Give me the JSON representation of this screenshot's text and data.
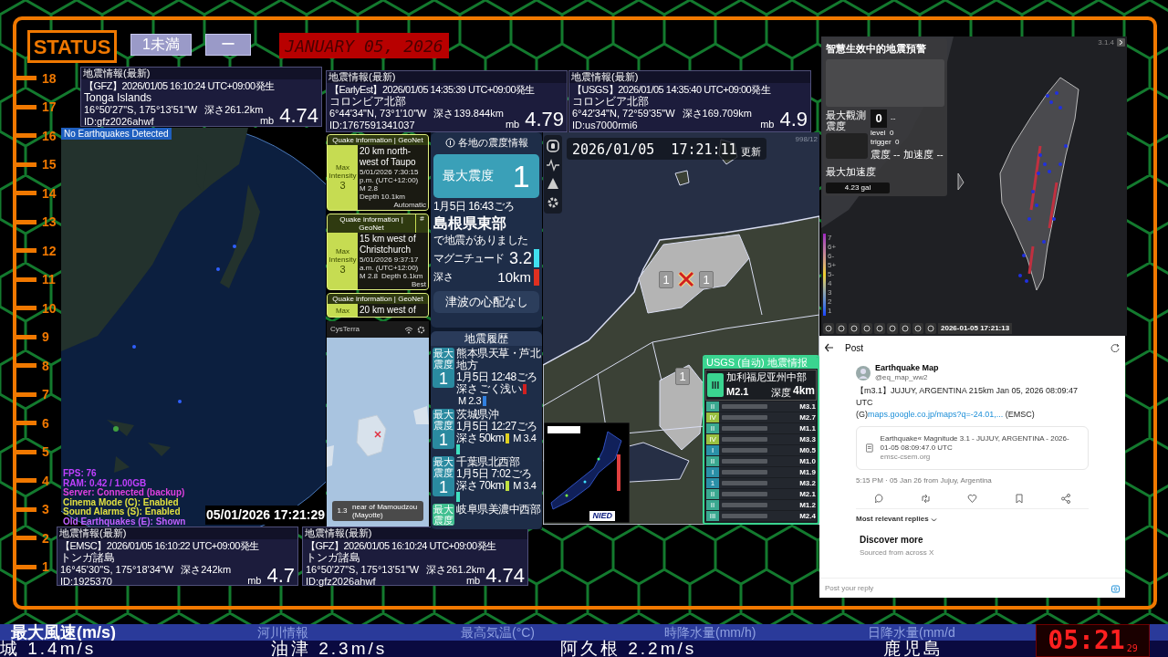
{
  "status": {
    "label": "STATUS",
    "badges": [
      "1未満",
      "ー"
    ],
    "date": "JANUARY 05, 2026"
  },
  "ruler": [
    "18",
    "17",
    "16",
    "15",
    "14",
    "13",
    "12",
    "11",
    "10",
    "9",
    "8",
    "7",
    "6",
    "5",
    "4",
    "3",
    "2",
    "1"
  ],
  "quake_cards": [
    {
      "header": "地震情報(最新)",
      "source": "【GFZ】2026/01/05  16:10:24  UTC+09:00発生",
      "region": "Tonga Islands",
      "coords": "16°50'27\"S, 175°13'51\"W",
      "depth": "深さ261.2km",
      "id": "ID:gfz2026ahwf",
      "mag_type": "mb",
      "magnitude": "4.74"
    },
    {
      "header": "地震情報(最新)",
      "source": "【EarlyEst】2026/01/05  14:35:39  UTC+09:00発生",
      "region": "コロンビア北部",
      "coords": "6°44'34\"N, 73°1'10\"W",
      "depth": "深さ139.844km",
      "id": "ID:1767591341037",
      "mag_type": "mb",
      "magnitude": "4.79"
    },
    {
      "header": "地震情報(最新)",
      "source": "【USGS】2026/01/05  14:35:40  UTC+09:00発生",
      "region": "コロンビア北部",
      "coords": "6°42'34\"N, 72°59'35\"W",
      "depth": "深さ169.709km",
      "id": "ID:us7000rmi6",
      "mag_type": "mb",
      "magnitude": "4.9"
    },
    {
      "header": "地震情報(最新)",
      "source": "【EMSC】2026/01/05  16:10:22  UTC+09:00発生",
      "region": "トンガ諸島",
      "coords": "16°45'30\"S, 175°18'34\"W",
      "depth": "深さ242km",
      "id": "ID:1925370",
      "mag_type": "mb",
      "magnitude": "4.7"
    },
    {
      "header": "地震情報(最新)",
      "source": "【GFZ】2026/01/05  16:10:24  UTC+09:00発生",
      "region": "トンガ諸島",
      "coords": "16°50'27\"S, 175°13'51\"W",
      "depth": "深さ261.2km",
      "id": "ID:gfz2026ahwf",
      "mag_type": "mb",
      "magnitude": "4.74"
    }
  ],
  "globe": {
    "badge": "No Earthquakes Detected",
    "stats": [
      {
        "text": "FPS: 76",
        "color": "#c040ff"
      },
      {
        "text": "RAM: 0.42 / 1.00GB",
        "color": "#c040ff"
      },
      {
        "text": "Server: Connected (backup)",
        "color": "#e040e0"
      },
      {
        "text": "Cinema Mode (C): Enabled",
        "color": "#e0e040"
      },
      {
        "text": "Sound Alarms (S): Enabled",
        "color": "#e0e040"
      },
      {
        "text": "Old Earthquakes (E): Shown",
        "color": "#c060ff"
      }
    ],
    "timestamp": "05/01/2026 17:21:29"
  },
  "geonet_cards": [
    {
      "header": "Quake information | GeoNet",
      "intensity_label": "Max Intensity",
      "intensity": "3",
      "place": "20 km north-west of Taupo",
      "time": "5/01/2026 7:30:15 p.m. (UTC+12:00)",
      "magnitude": "M 2.8",
      "depth": "Depth 10.1km",
      "quality": "Automatic"
    },
    {
      "header": "Quake information | GeoNet",
      "extra": "#",
      "intensity_label": "Max Intensity",
      "intensity": "3",
      "place": "15 km west of Christchurch",
      "time": "5/01/2026 9:37:17 a.m. (UTC+12:00)",
      "magnitude": "M 2.8",
      "depth": "Depth 6.1km",
      "quality": "Best"
    },
    {
      "header": "Quake information | GeoNet",
      "intensity_label": "Max",
      "place": "20 km west of"
    }
  ],
  "mayotte": {
    "app": "CysTerra",
    "magnitude": "1.3",
    "place": "near of Mamoudzou (Mayotte)"
  },
  "intensity": {
    "title": "各地の震度情報",
    "max_label": "最大震度",
    "max_value": "1",
    "time": "1月5日 16:43ごろ",
    "region": "島根県東部",
    "note": "で地震がありました",
    "magnitude_label": "マグニチュード",
    "magnitude": {
      "text": "3.2",
      "color": "#40e0f0"
    },
    "depth_label": "深さ",
    "depth": {
      "text": "10km",
      "color": "#e03020"
    },
    "tsunami": "津波の心配なし",
    "history_title": "地震履歴",
    "history": [
      {
        "badge": "最大震度",
        "intensity": "1",
        "region": "熊本県天草・芦北地方",
        "time": "1月5日 12:48ごろ",
        "depth_label": "深さ",
        "depth": {
          "text": "ごく浅い",
          "color": "#d02020"
        },
        "magnitude": {
          "text": "M 2.3",
          "color": "#3080e0"
        }
      },
      {
        "badge": "最大震度",
        "intensity": "1",
        "region": "茨城県沖",
        "time": "1月5日 12:27ごろ",
        "depth_label": "深さ",
        "depth": {
          "text": "50km",
          "color": "#e0d020"
        },
        "magnitude": {
          "text": "M 3.4",
          "color": "#40e0c0"
        }
      },
      {
        "badge": "最大震度",
        "intensity": "1",
        "region": "千葉県北西部",
        "time": "1月5日 7:02ごろ",
        "depth_label": "深さ",
        "depth": {
          "text": "70km",
          "color": "#c0e040"
        },
        "magnitude": {
          "text": "M 3.4",
          "color": "#40e0c0"
        }
      },
      {
        "badge": "最大震度",
        "region": "岐阜県美濃中西部"
      }
    ]
  },
  "jp_map": {
    "timestamp": "2026/01/05  17:21:11",
    "updated": "更新",
    "counter": "998/12",
    "markers": [
      "1",
      "1",
      "1"
    ],
    "nied": "NIED",
    "usgs": {
      "title": "USGS (自动) 地震情报",
      "intensity": "III",
      "region": "加利福尼亚州中部",
      "magnitude": "M2.1",
      "depth_label": "深度",
      "depth": "4km",
      "list": [
        {
          "intensity": "II",
          "magnitude": "M3.1",
          "color": "#3aa890"
        },
        {
          "intensity": "IV",
          "magnitude": "M2.7",
          "color": "#9ac040"
        },
        {
          "intensity": "II",
          "magnitude": "M1.1",
          "color": "#3aa890"
        },
        {
          "intensity": "IV",
          "magnitude": "M3.3",
          "color": "#9ac040"
        },
        {
          "intensity": "I",
          "magnitude": "M0.5",
          "color": "#2a90a8"
        },
        {
          "intensity": "II",
          "magnitude": "M1.0",
          "color": "#3aa890"
        },
        {
          "intensity": "I",
          "magnitude": "M1.9",
          "color": "#2a90a8"
        },
        {
          "intensity": "1",
          "magnitude": "M3.2",
          "color": "#2a90a8"
        },
        {
          "intensity": "II",
          "magnitude": "M2.1",
          "color": "#3aa890"
        },
        {
          "intensity": "II",
          "magnitude": "M1.2",
          "color": "#3aa890"
        },
        {
          "intensity": "III",
          "magnitude": "M2.4",
          "color": "#3aa890"
        }
      ]
    }
  },
  "taiwan": {
    "title": "智慧生效中的地震預警",
    "version": "3.1.4",
    "max_obs_label": "最大觀測震度",
    "count": "0",
    "dash": "--",
    "level": "level  0",
    "trigger": "trigger  0",
    "shindo": "震度 --",
    "accel": "加速度 --",
    "max_accel_label": "最大加速度",
    "max_accel": "4.23 gal",
    "scale": [
      "7",
      "6+",
      "6-",
      "5+",
      "5-",
      "4",
      "3",
      "2",
      "1"
    ],
    "timestamp": "2026-01-05 17:21:13"
  },
  "post": {
    "title": "Post",
    "name": "Earthquake Map",
    "handle": "@eq_map_ww2",
    "text": "【m3.1】JUJUY, ARGENTINA 215km Jan 05, 2026 08:09:47 UTC",
    "prefix": "(G)",
    "link": "maps.google.co.jp/maps?q=-24.01,...",
    "suffix": " (EMSC)",
    "card_title": "Earthquake« Magnitude 3.1 - JUJUY, ARGENTINA - 2026-01-05 08:09:47.0 UTC",
    "card_domain": "emsc-csem.org",
    "meta": "5:15 PM · 05 Jan 26 from Jujuy, Argentina",
    "replies": "Most relevant replies",
    "discover": "Discover more",
    "discover_sub": "Sourced from across X",
    "reply_placeholder": "Post your reply"
  },
  "ticker": {
    "headings": [
      {
        "text": "最大風速(m/s)",
        "active": true
      },
      {
        "text": "河川情報",
        "active": false
      },
      {
        "text": "最高気温(°C)",
        "active": false
      },
      {
        "text": "時降水量(mm/h)",
        "active": false
      },
      {
        "text": "日降水量(mm/d",
        "active": false
      }
    ],
    "values": [
      "城 1.4m/s",
      "油津 2.3m/s",
      "阿久根 2.2m/s",
      "鹿児島"
    ]
  },
  "clock": {
    "time": "05:21",
    "seconds": "29"
  }
}
